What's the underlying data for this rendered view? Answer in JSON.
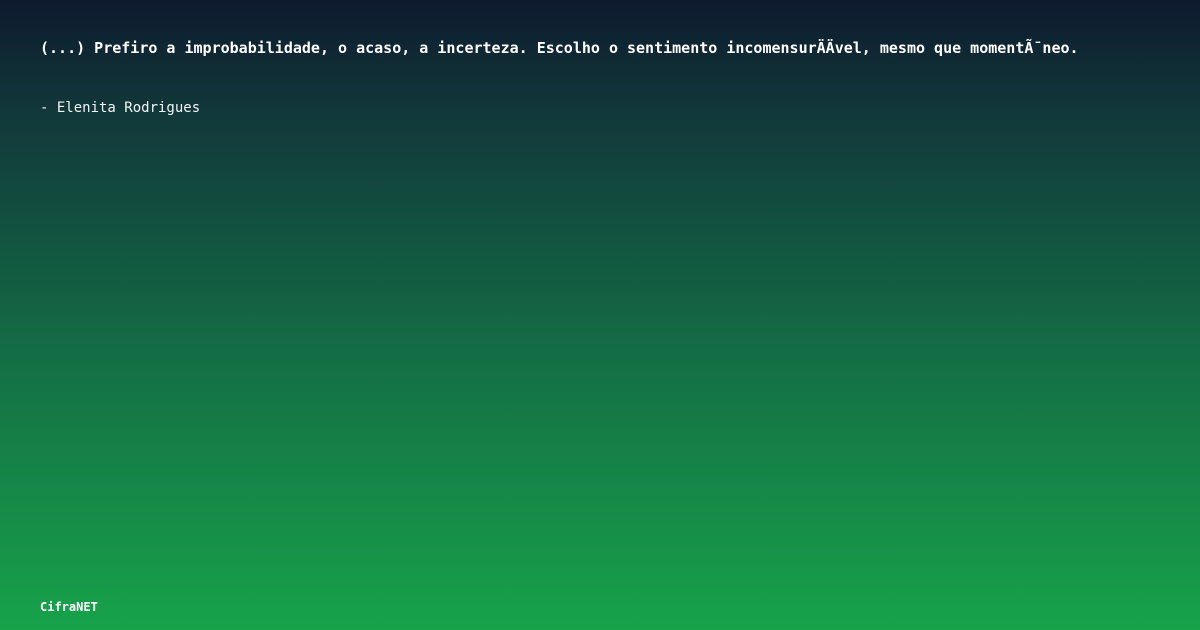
{
  "quote": {
    "text": "(...) Prefiro a improbabilidade, o acaso, a incerteza. Escolho o sentimento incomensurÄÄvel, mesmo que momentÃ¯neo.",
    "author": "- Elenita Rodrigues"
  },
  "brand": {
    "name": "CifraNET"
  },
  "colors": {
    "gradient_top": "#0e1a2e",
    "gradient_bottom": "#17a34a",
    "text": "#ffffff"
  }
}
